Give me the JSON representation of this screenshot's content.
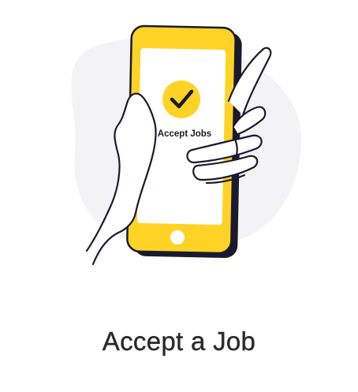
{
  "onboarding": {
    "illustration": {
      "phone_screen_label": "Accept Jobs",
      "check_icon": "check-circle-icon",
      "colors": {
        "phone_yellow": "#FFD226",
        "outline": "#1A1A2E",
        "backdrop": "#F3F3F6",
        "screen": "#FFFFFF"
      }
    },
    "title": "Accept a Job"
  }
}
